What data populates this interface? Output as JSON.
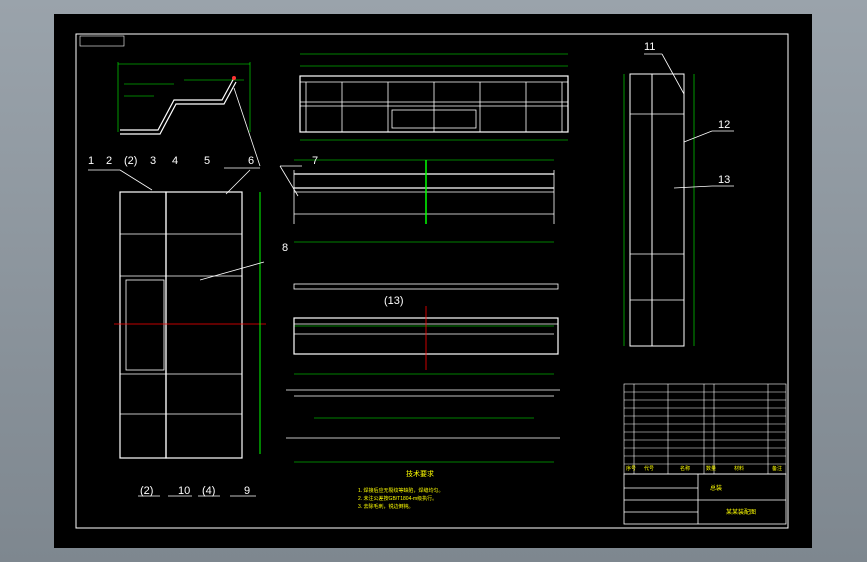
{
  "drawing": {
    "callouts": [
      {
        "id": "c1",
        "text": "1"
      },
      {
        "id": "c2",
        "text": "2"
      },
      {
        "id": "c2b",
        "text": "(2)"
      },
      {
        "id": "c3",
        "text": "3"
      },
      {
        "id": "c4",
        "text": "4"
      },
      {
        "id": "c5",
        "text": "5"
      },
      {
        "id": "c6",
        "text": "6"
      },
      {
        "id": "c7",
        "text": "7"
      },
      {
        "id": "c8",
        "text": "8"
      },
      {
        "id": "c9",
        "text": "9"
      },
      {
        "id": "c10",
        "text": "10"
      },
      {
        "id": "c2c",
        "text": "(2)"
      },
      {
        "id": "c4b",
        "text": "(4)"
      },
      {
        "id": "c11",
        "text": "11"
      },
      {
        "id": "c12",
        "text": "12"
      },
      {
        "id": "c13",
        "text": "13"
      },
      {
        "id": "c13b",
        "text": "(13)"
      }
    ],
    "tech_notes": {
      "title": "技术要求",
      "lines": [
        "1. 焊接后应无裂纹等缺陷，焊缝均匀。",
        "2. 未注公差按GB/T1804-m级执行。",
        "3. 去除毛刺，锐边倒钝。"
      ]
    }
  },
  "title_block": {
    "header_cells": [
      "序号",
      "代号",
      "名称",
      "数量",
      "材料",
      "备注"
    ],
    "drawing_name": "某某装配图",
    "part_label": "总装"
  },
  "colors": {
    "sheet_bg": "#000000",
    "line": "#ffffff",
    "dimension": "#00ff00",
    "center": "#ff0000",
    "outer_frame": "#9aa3ab"
  }
}
